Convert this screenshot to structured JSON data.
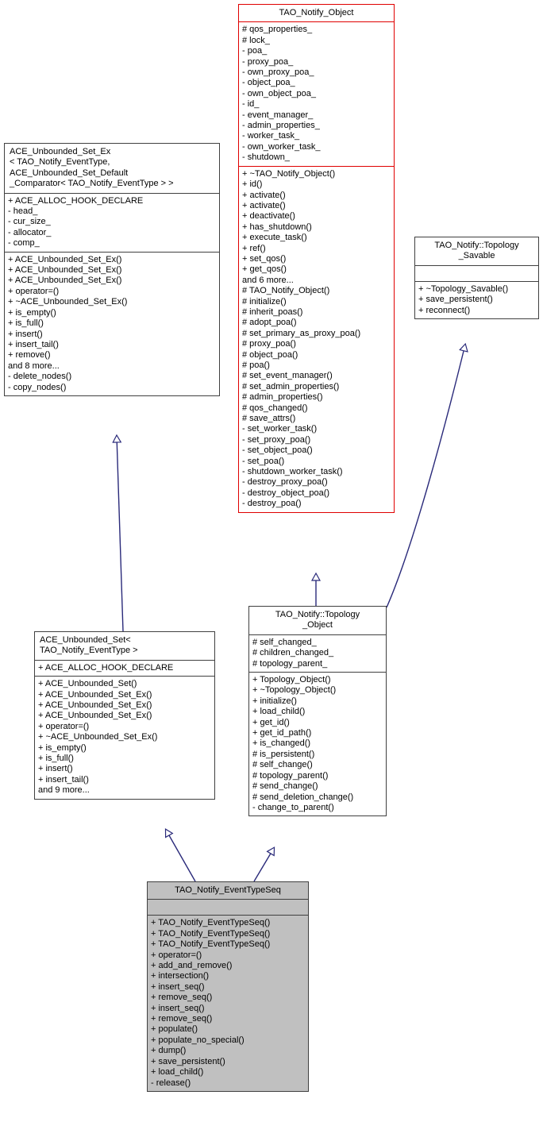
{
  "diagram": {
    "kind": "uml-class-inheritance-diagram",
    "colors": {
      "highlight_border": "#e00000",
      "normal_border": "#404040",
      "edge": "#2a2a7a",
      "selected_fill": "#c0c0c0",
      "default_fill": "#ffffff"
    }
  },
  "classes": {
    "tao_notify_object": {
      "name": "TAO_Notify_Object",
      "attributes": [
        "# qos_properties_",
        "# lock_",
        "- poa_",
        "- proxy_poa_",
        "- own_proxy_poa_",
        "- object_poa_",
        "- own_object_poa_",
        "- id_",
        "- event_manager_",
        "- admin_properties_",
        "- worker_task_",
        "- own_worker_task_",
        "- shutdown_"
      ],
      "operations": [
        "+ ~TAO_Notify_Object()",
        "+ id()",
        "+ activate()",
        "+ activate()",
        "+ deactivate()",
        "+ has_shutdown()",
        "+ execute_task()",
        "+ ref()",
        "+ set_qos()",
        "+ get_qos()",
        "and 6 more...",
        "# TAO_Notify_Object()",
        "# initialize()",
        "# inherit_poas()",
        "# adopt_poa()",
        "# set_primary_as_proxy_poa()",
        "# proxy_poa()",
        "# object_poa()",
        "# poa()",
        "# set_event_manager()",
        "# set_admin_properties()",
        "# admin_properties()",
        "# qos_changed()",
        "# save_attrs()",
        "- set_worker_task()",
        "- set_proxy_poa()",
        "- set_object_poa()",
        "- set_poa()",
        "- shutdown_worker_task()",
        "- destroy_proxy_poa()",
        "- destroy_object_poa()",
        "- destroy_poa()"
      ]
    },
    "ace_unbounded_set_ex": {
      "name": "ACE_Unbounded_Set_Ex\n< TAO_Notify_EventType,\n ACE_Unbounded_Set_Default\n_Comparator< TAO_Notify_EventType > >",
      "attributes": [
        "+ ACE_ALLOC_HOOK_DECLARE",
        "- head_",
        "- cur_size_",
        "- allocator_",
        "- comp_"
      ],
      "operations": [
        "+ ACE_Unbounded_Set_Ex()",
        "+ ACE_Unbounded_Set_Ex()",
        "+ ACE_Unbounded_Set_Ex()",
        "+ operator=()",
        "+ ~ACE_Unbounded_Set_Ex()",
        "+ is_empty()",
        "+ is_full()",
        "+ insert()",
        "+ insert_tail()",
        "+ remove()",
        "and 8 more...",
        "- delete_nodes()",
        "- copy_nodes()"
      ]
    },
    "topology_savable": {
      "name": "TAO_Notify::Topology\n_Savable",
      "attributes": [],
      "operations": [
        "+ ~Topology_Savable()",
        "+ save_persistent()",
        "+ reconnect()"
      ]
    },
    "ace_unbounded_set": {
      "name": "ACE_Unbounded_Set<\n TAO_Notify_EventType >",
      "attributes": [
        "+ ACE_ALLOC_HOOK_DECLARE"
      ],
      "operations": [
        "+ ACE_Unbounded_Set()",
        "+ ACE_Unbounded_Set_Ex()",
        "+ ACE_Unbounded_Set_Ex()",
        "+ ACE_Unbounded_Set_Ex()",
        "+ operator=()",
        "+ ~ACE_Unbounded_Set_Ex()",
        "+ is_empty()",
        "+ is_full()",
        "+ insert()",
        "+ insert_tail()",
        "and 9 more..."
      ]
    },
    "topology_object": {
      "name": "TAO_Notify::Topology\n_Object",
      "attributes": [
        "# self_changed_",
        "# children_changed_",
        "# topology_parent_"
      ],
      "operations": [
        "+ Topology_Object()",
        "+ ~Topology_Object()",
        "+ initialize()",
        "+ load_child()",
        "+ get_id()",
        "+ get_id_path()",
        "+ is_changed()",
        "# is_persistent()",
        "# self_change()",
        "# topology_parent()",
        "# send_change()",
        "# send_deletion_change()",
        "- change_to_parent()"
      ]
    },
    "tao_notify_eventtypeseq": {
      "name": "TAO_Notify_EventTypeSeq",
      "attributes": [],
      "operations": [
        "+ TAO_Notify_EventTypeSeq()",
        "+ TAO_Notify_EventTypeSeq()",
        "+ TAO_Notify_EventTypeSeq()",
        "+ operator=()",
        "+ add_and_remove()",
        "+ intersection()",
        "+ insert_seq()",
        "+ remove_seq()",
        "+ insert_seq()",
        "+ remove_seq()",
        "+ populate()",
        "+ populate_no_special()",
        "+ dump()",
        "+ save_persistent()",
        "+ load_child()",
        "- release()"
      ]
    }
  },
  "edges": [
    {
      "name": "inheritance-set-to-set-ex",
      "from": "ace_unbounded_set",
      "to": "ace_unbounded_set_ex",
      "type": "generalization"
    },
    {
      "name": "inheritance-topobj-to-notifyobj",
      "from": "topology_object",
      "to": "tao_notify_object",
      "type": "generalization"
    },
    {
      "name": "inheritance-topobj-to-savable",
      "from": "topology_object",
      "to": "topology_savable",
      "type": "generalization"
    },
    {
      "name": "inheritance-seq-to-set",
      "from": "tao_notify_eventtypeseq",
      "to": "ace_unbounded_set",
      "type": "generalization"
    },
    {
      "name": "inheritance-seq-to-topobj",
      "from": "tao_notify_eventtypeseq",
      "to": "topology_object",
      "type": "generalization"
    }
  ]
}
